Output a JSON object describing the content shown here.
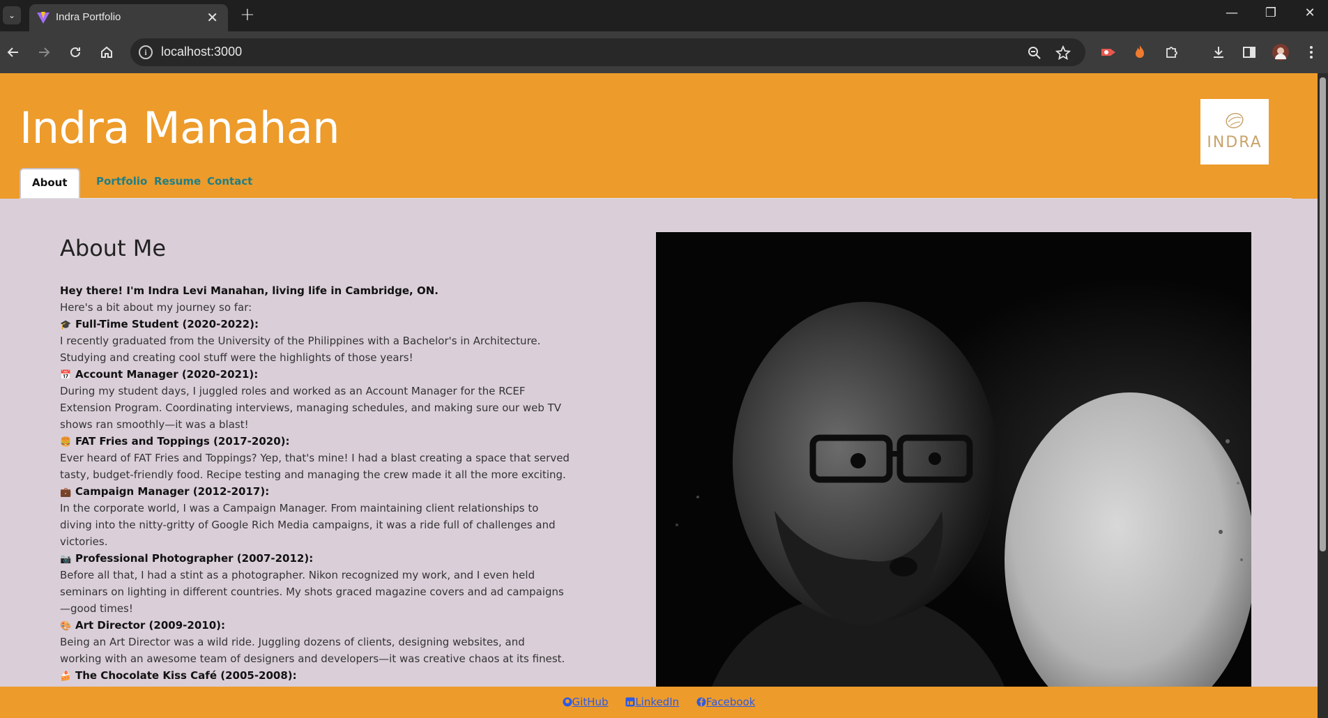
{
  "browser": {
    "tab_title": "Indra Portfolio",
    "url": "localhost:3000"
  },
  "header": {
    "title": "Indra Manahan",
    "logo_text": "INDRA",
    "nav": [
      {
        "label": "About",
        "active": true
      },
      {
        "label": "Portfolio",
        "active": false
      },
      {
        "label": "Resume",
        "active": false
      },
      {
        "label": "Contact",
        "active": false
      }
    ]
  },
  "about": {
    "heading": "About Me",
    "intro_bold": "Hey there! I'm Indra Levi Manahan, living life in Cambridge, ON.",
    "intro": "Here's a bit about my journey so far:",
    "sections": [
      {
        "icon": "🎓",
        "title": "Full-Time Student (2020-2022):",
        "lines": [
          "I recently graduated from the University of the Philippines with a Bachelor's in Architecture.",
          "Studying and creating cool stuff were the highlights of those years!"
        ]
      },
      {
        "icon": "📅",
        "title": "Account Manager (2020-2021):",
        "lines": [
          "During my student days, I juggled roles and worked as an Account Manager for the RCEF",
          "Extension Program. Coordinating interviews, managing schedules, and making sure our web TV",
          "shows ran smoothly—it was a blast!"
        ]
      },
      {
        "icon": "🍔",
        "title": "FAT Fries and Toppings (2017-2020):",
        "lines": [
          "Ever heard of FAT Fries and Toppings? Yep, that's mine! I had a blast creating a space that served",
          "tasty, budget-friendly food. Recipe testing and managing the crew made it all the more exciting."
        ]
      },
      {
        "icon": "💼",
        "title": "Campaign Manager (2012-2017):",
        "lines": [
          "In the corporate world, I was a Campaign Manager. From maintaining client relationships to",
          "diving into the nitty-gritty of Google Rich Media campaigns, it was a ride full of challenges and",
          "victories."
        ]
      },
      {
        "icon": "📷",
        "title": "Professional Photographer (2007-2012):",
        "lines": [
          "Before all that, I had a stint as a photographer. Nikon recognized my work, and I even held",
          "seminars on lighting in different countries. My shots graced magazine covers and ad campaigns",
          "—good times!"
        ]
      },
      {
        "icon": "🎨",
        "title": "Art Director (2009-2010):",
        "lines": [
          "Being an Art Director was a wild ride. Juggling dozens of clients, designing websites, and",
          "working with an awesome team of designers and developers—it was creative chaos at its finest."
        ]
      },
      {
        "icon": "🍰",
        "title": "The Chocolate Kiss Café (2005-2008):",
        "lines": []
      }
    ]
  },
  "footer": {
    "links": [
      "GitHub",
      "LinkedIn",
      "Facebook"
    ]
  },
  "colors": {
    "header_bg": "#ed9b2b",
    "page_bg": "#dacfd9",
    "nav_link": "#1f7f86",
    "footer_link": "#2d5be3"
  }
}
